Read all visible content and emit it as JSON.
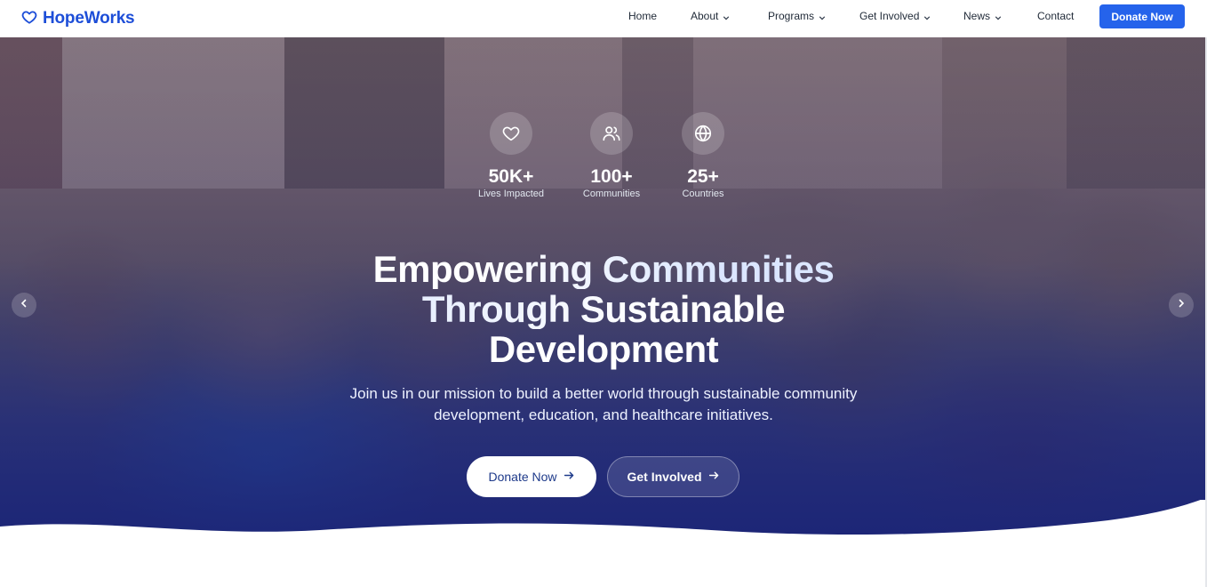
{
  "brand": {
    "name": "HopeWorks",
    "icon": "heart-icon",
    "color": "#1d4ed8"
  },
  "nav": {
    "items": [
      {
        "label": "Home",
        "dropdown": false
      },
      {
        "label": "About",
        "dropdown": true
      },
      {
        "label": "Programs",
        "dropdown": true
      },
      {
        "label": "Get Involved",
        "dropdown": true
      },
      {
        "label": "News",
        "dropdown": true
      },
      {
        "label": "Contact",
        "dropdown": false
      }
    ],
    "cta_label": "Donate Now",
    "cta_color": "#2563eb"
  },
  "hero": {
    "stats": [
      {
        "icon": "heart-icon",
        "value": "50K+",
        "label": "Lives Impacted"
      },
      {
        "icon": "users-icon",
        "value": "100+",
        "label": "Communities"
      },
      {
        "icon": "globe-icon",
        "value": "25+",
        "label": "Countries"
      }
    ],
    "headline": {
      "line1": "Empowering Communities",
      "line2": "Through Sustainable",
      "line3": "Development"
    },
    "subtitle_line1": "Join us in our mission to build a better world through sustainable community",
    "subtitle_line2": "development, education, and healthcare initiatives.",
    "primary_button": "Donate Now",
    "secondary_button": "Get Involved",
    "prev_icon": "chevron-left-icon",
    "next_icon": "chevron-right-icon"
  }
}
